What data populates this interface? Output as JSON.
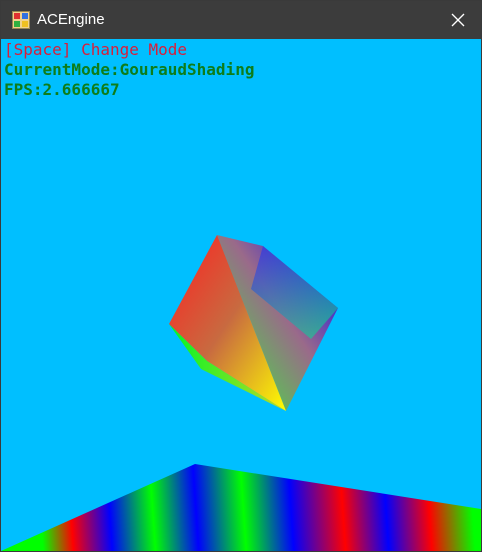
{
  "window": {
    "title": "ACEngine",
    "background": "#00bfff",
    "icon": "app-icon",
    "close_icon": "close-icon"
  },
  "hud": {
    "hint": "[Space] Change Mode",
    "mode": "CurrentMode:GouraudShading",
    "fps": "FPS:2.666667",
    "hint_color": "#d91e3a",
    "info_color": "#0e7d1a"
  },
  "scene": {
    "shading_mode": "GouraudShading",
    "objects": [
      "cube",
      "floor-plane"
    ],
    "vertex_colors": [
      "#ff0000",
      "#00ff00",
      "#0000ff",
      "#ffff00"
    ]
  }
}
